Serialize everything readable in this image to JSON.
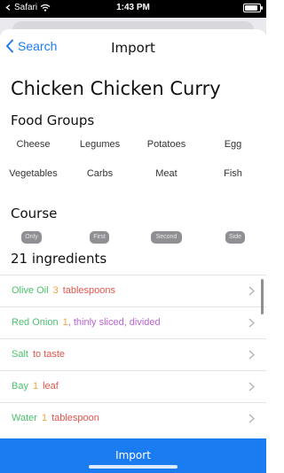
{
  "status_bar": {
    "carrier": "Safari",
    "time": "1:43 PM",
    "icons": [
      "wifi-icon",
      "battery-icon"
    ]
  },
  "nav": {
    "back_label": "Search",
    "title": "Import"
  },
  "recipe": {
    "title": "Chicken Chicken Curry"
  },
  "food_groups": {
    "title": "Food Groups",
    "items": [
      "Cheese",
      "Legumes",
      "Potatoes",
      "Egg",
      "Vegetables",
      "Carbs",
      "Meat",
      "Fish"
    ]
  },
  "course": {
    "title": "Course",
    "options": [
      "Only",
      "First",
      "Second",
      "Side"
    ]
  },
  "ingredients": {
    "title": "21 ingredients",
    "items": [
      {
        "name": "Olive Oil",
        "qty": "3",
        "unit": "tablespoons",
        "note": ""
      },
      {
        "name": "Red Onion",
        "qty": "1",
        "unit": "",
        "note": ", thinly sliced, divided"
      },
      {
        "name": "Salt",
        "qty": "",
        "unit": "to taste",
        "note": ""
      },
      {
        "name": "Bay",
        "qty": "1",
        "unit": "leaf",
        "note": ""
      },
      {
        "name": "Water",
        "qty": "1",
        "unit": "tablespoon",
        "note": ""
      }
    ]
  },
  "footer": {
    "import_label": "Import"
  },
  "colors": {
    "accent": "#1b7cf2",
    "ingredient_name": "#4cc26e",
    "quantity": "#f0a63c",
    "unit": "#e0564e",
    "note": "#bb63d4",
    "pill": "#8f8f94"
  }
}
